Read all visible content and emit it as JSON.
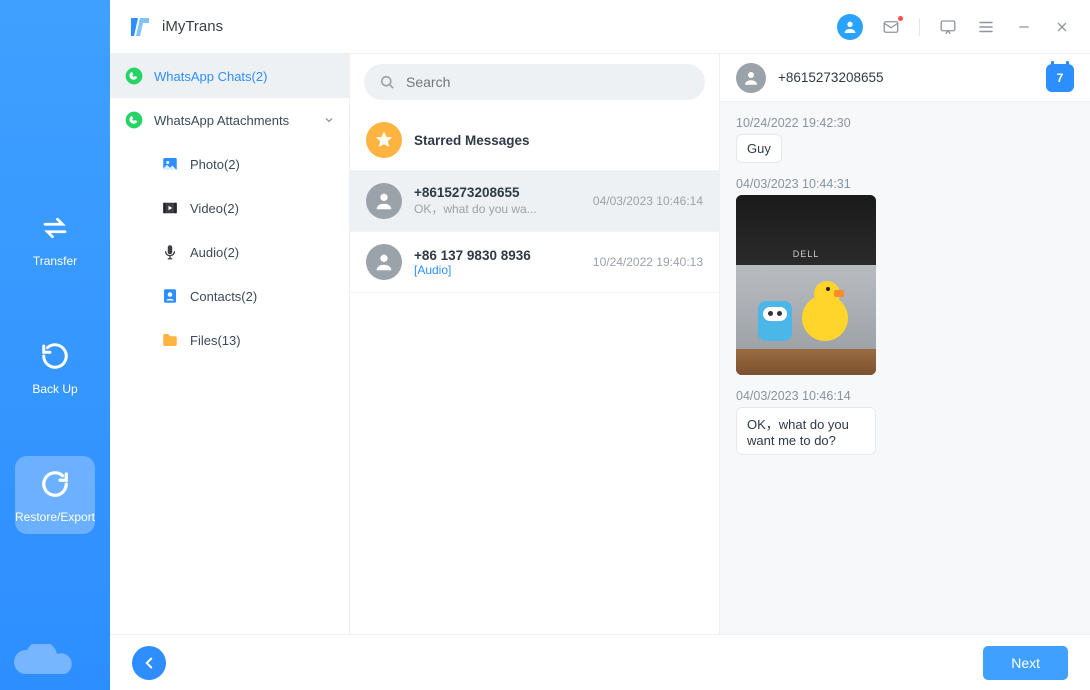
{
  "app": {
    "name": "iMyTrans"
  },
  "nav": {
    "transfer": "Transfer",
    "backup": "Back Up",
    "restore": "Restore/Export"
  },
  "tree": {
    "chats_label": "WhatsApp Chats(2)",
    "attachments_label": "WhatsApp Attachments",
    "photo": "Photo(2)",
    "video": "Video(2)",
    "audio": "Audio(2)",
    "contacts": "Contacts(2)",
    "files": "Files(13)"
  },
  "search": {
    "placeholder": "Search"
  },
  "chatlist": {
    "starred": "Starred Messages",
    "items": [
      {
        "title": "+8615273208655",
        "sub": "OK，what do you wa...",
        "time": "04/03/2023 10:46:14"
      },
      {
        "title": "+86 137 9830 8936",
        "sub": "[Audio]",
        "time": "10/24/2022 19:40:13"
      }
    ]
  },
  "conversation": {
    "contact": "+8615273208655",
    "calendar_day": "7",
    "messages": [
      {
        "ts": "10/24/2022 19:42:30",
        "text": "Guy"
      },
      {
        "ts": "04/03/2023 10:44:31",
        "image": true
      },
      {
        "ts": "04/03/2023 10:46:14",
        "text": "OK，what do you want me to do?"
      }
    ]
  },
  "footer": {
    "next": "Next"
  }
}
